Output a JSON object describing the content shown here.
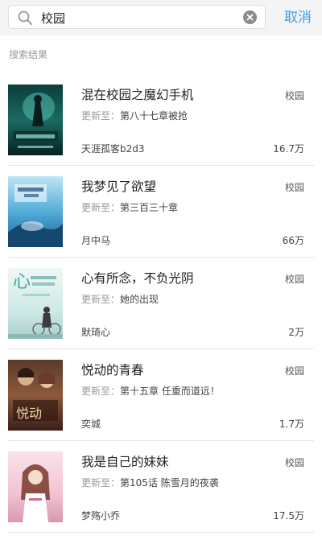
{
  "search": {
    "value": "校园"
  },
  "cancel_label": "取消",
  "section_label": "搜索结果",
  "update_prefix": "更新至：",
  "colors": {
    "accent": "#3d9ee5",
    "bar_background": "#f4f4f4",
    "divider": "#e6e6e6"
  },
  "books": [
    {
      "title": "混在校园之魔幻手机",
      "tag": "校园",
      "chapter": "第八十七章被抢",
      "author": "天涯孤客b2d3",
      "count": "16.7万"
    },
    {
      "title": "我梦见了欲望",
      "tag": "校园",
      "chapter": "第三百三十章",
      "author": "月中马",
      "count": "66万"
    },
    {
      "title": "心有所念，不负光阴",
      "tag": "校园",
      "chapter": "她的出现",
      "author": "默琦心",
      "count": "2万"
    },
    {
      "title": "悦动的青春",
      "tag": "校园",
      "chapter": "第十五章  任重而道远！",
      "author": "奕城",
      "count": "1.7万"
    },
    {
      "title": "我是自己的妹妹",
      "tag": "校园",
      "chapter": "第105话 陈雪月的夜袭",
      "author": "梦殇小乔",
      "count": "17.5万"
    }
  ]
}
